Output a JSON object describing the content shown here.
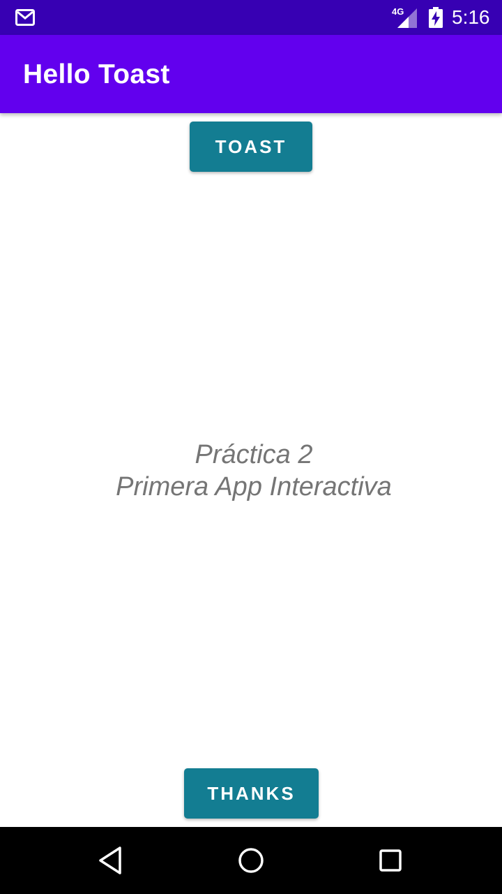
{
  "status_bar": {
    "time": "5:16",
    "network": "4G",
    "icons": [
      "gmail-icon",
      "signal-icon",
      "battery-charging-icon"
    ],
    "background_color": "#3700b3"
  },
  "app_bar": {
    "title": "Hello Toast",
    "background_color": "#6200ee"
  },
  "main": {
    "toast_button_label": "TOAST",
    "message_line_1": "Práctica 2",
    "message_line_2": "Primera App Interactiva",
    "thanks_button_label": "THANKS",
    "button_color": "#137d92"
  },
  "nav_bar": {
    "icons": [
      "back-icon",
      "home-icon",
      "recents-icon"
    ]
  }
}
